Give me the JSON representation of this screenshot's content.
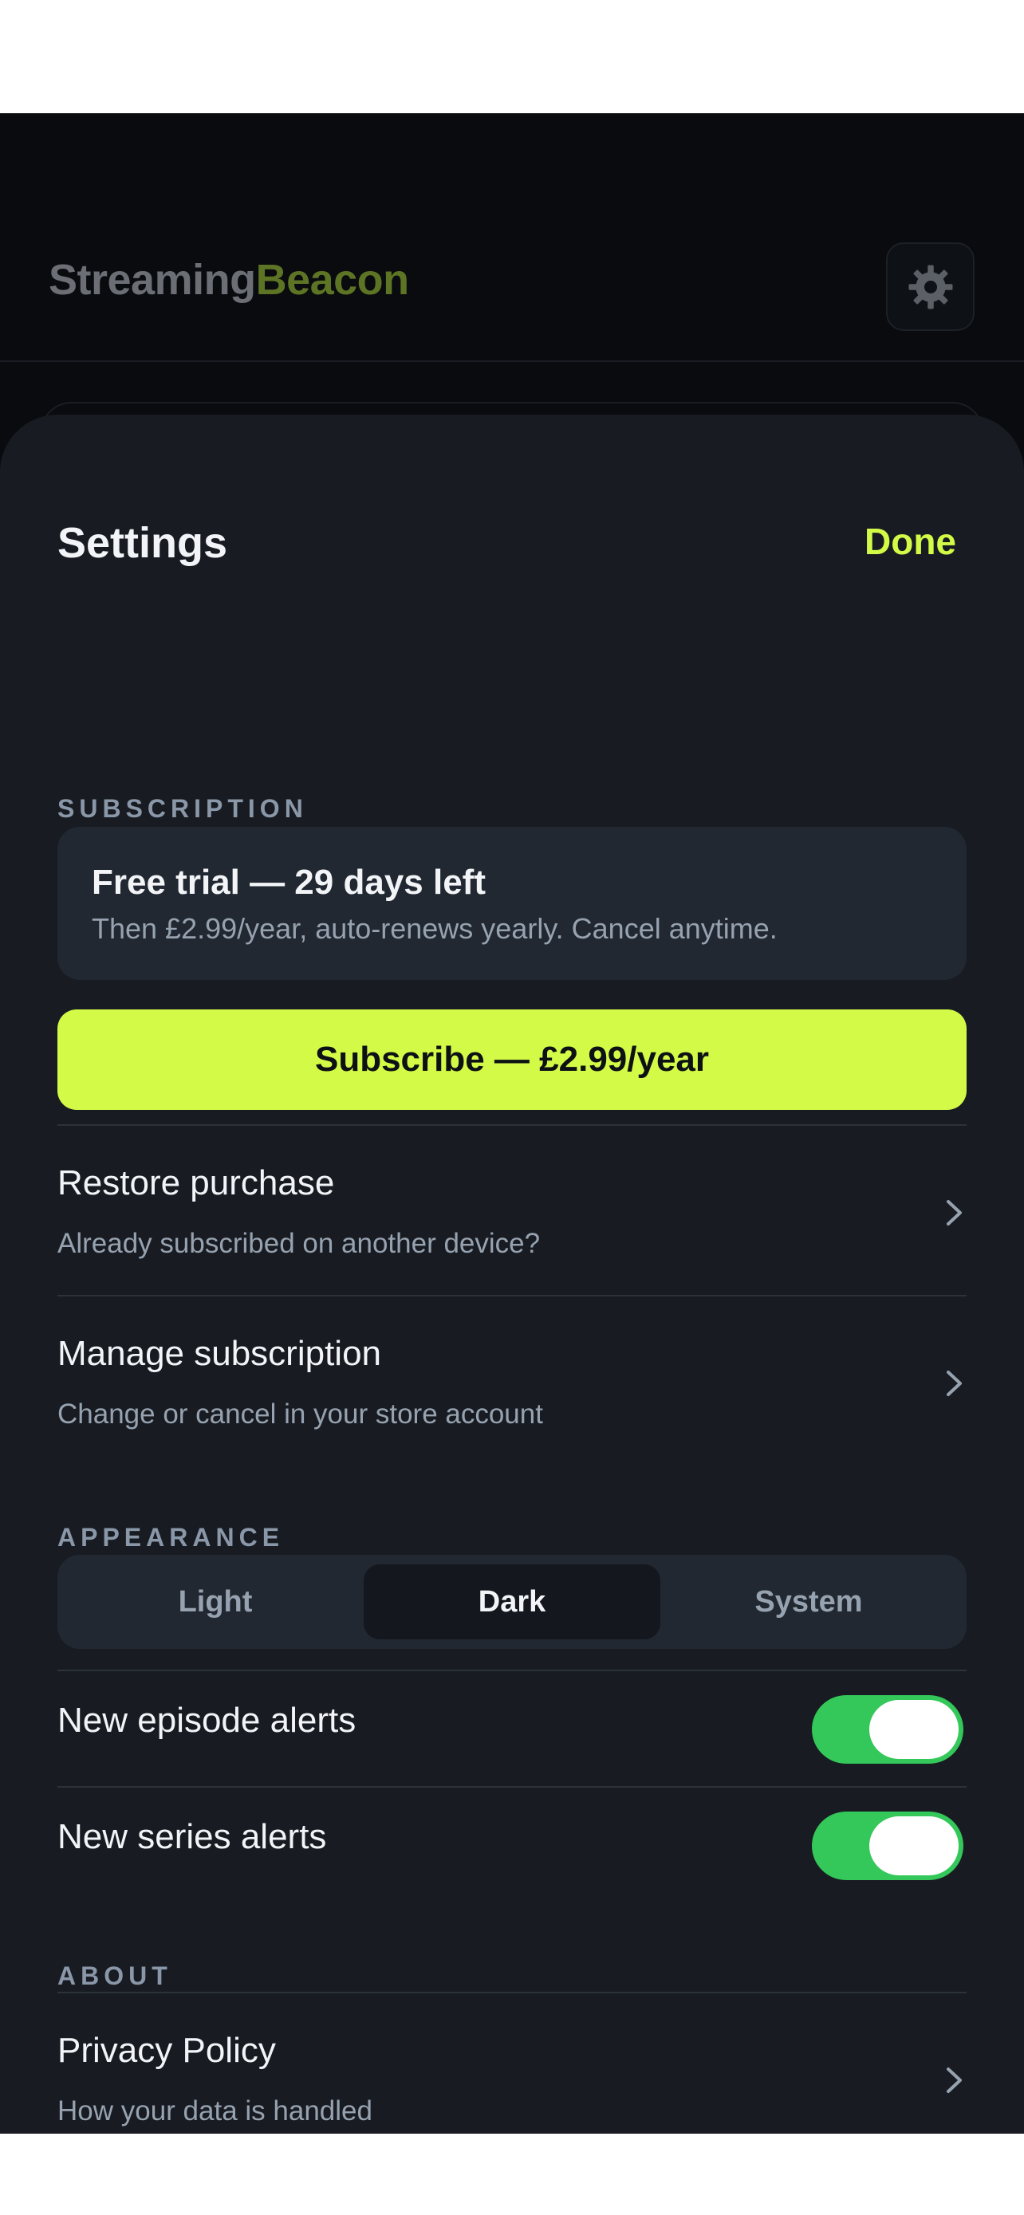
{
  "app": {
    "brand_part1": "Streaming",
    "brand_part2": "Beacon"
  },
  "sheet": {
    "title": "Settings",
    "done_label": "Done"
  },
  "subscription": {
    "section_label": "SUBSCRIPTION",
    "trial_title": "Free trial — 29 days left",
    "trial_subtitle": "Then £2.99/year, auto-renews yearly. Cancel anytime.",
    "subscribe_label": "Subscribe — £2.99/year",
    "restore": {
      "title": "Restore purchase",
      "subtitle": "Already subscribed on another device?"
    },
    "manage": {
      "title": "Manage subscription",
      "subtitle": "Change or cancel in your store account"
    }
  },
  "appearance": {
    "section_label": "APPEARANCE",
    "options": [
      "Light",
      "Dark",
      "System"
    ],
    "selected": "Dark"
  },
  "notifications": {
    "episode_alerts_label": "New episode alerts",
    "episode_alerts_on": true,
    "series_alerts_label": "New series alerts",
    "series_alerts_on": true
  },
  "about": {
    "section_label": "ABOUT",
    "privacy": {
      "title": "Privacy Policy",
      "subtitle": "How your data is handled"
    }
  },
  "colors": {
    "accent": "#d2fa46",
    "toggle_on": "#34c759",
    "sheet_bg": "#181c22",
    "app_bg": "#090b0e"
  },
  "icons": {
    "settings": "gear-icon",
    "row_chevron": "chevron-right-icon"
  }
}
